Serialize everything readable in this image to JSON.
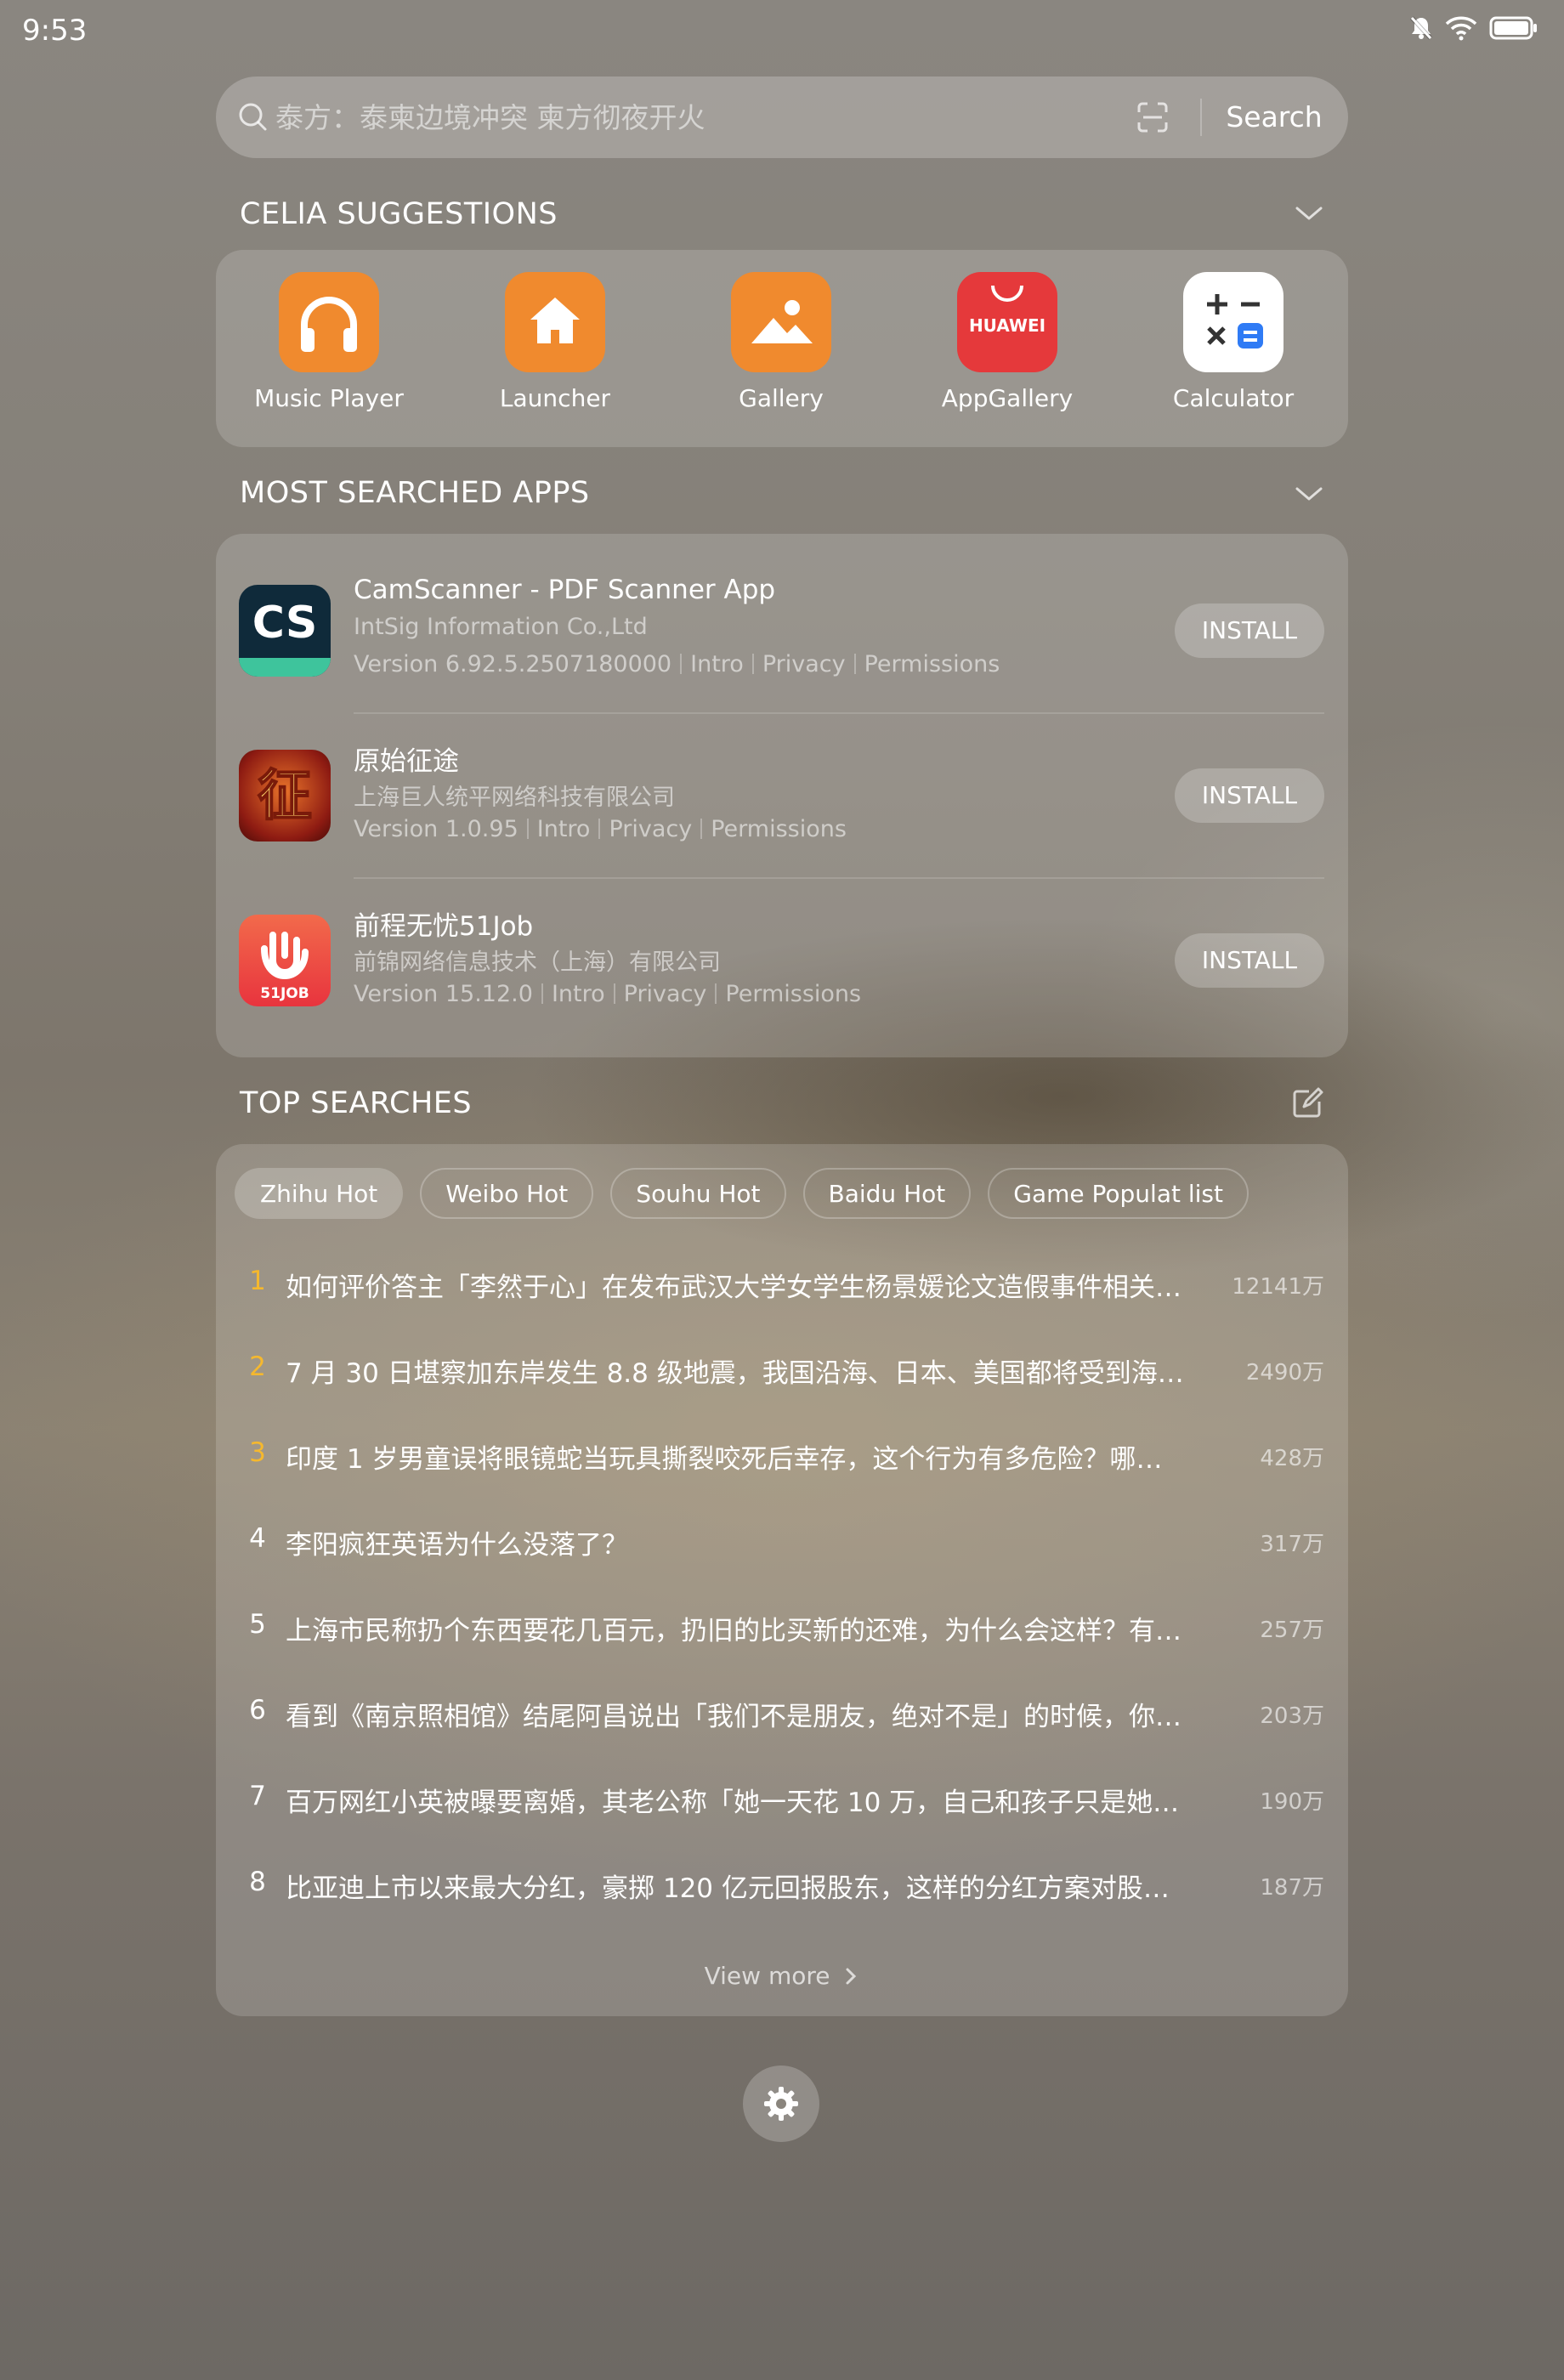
{
  "status_bar": {
    "time": "9:53",
    "icons": [
      "mute-bell-icon",
      "wifi-icon",
      "battery-icon"
    ]
  },
  "search": {
    "placeholder": "泰方：泰柬边境冲突 柬方彻夜开火",
    "button_label": "Search",
    "icons": [
      "search-icon",
      "scan-icon"
    ]
  },
  "celia": {
    "title": "CELIA SUGGESTIONS",
    "items": [
      {
        "label": "Music Player",
        "icon": "headphones-icon",
        "color": "#F08A2E"
      },
      {
        "label": "Launcher",
        "icon": "home-icon",
        "color": "#F08A2E"
      },
      {
        "label": "Gallery",
        "icon": "picture-icon",
        "color": "#F08A2E"
      },
      {
        "label": "AppGallery",
        "icon": "huawei-appgallery-icon",
        "color": "#E5393B",
        "brand": "HUAWEI"
      },
      {
        "label": "Calculator",
        "icon": "calculator-icon",
        "color": "#FFFFFF"
      }
    ]
  },
  "most_searched": {
    "title": "MOST SEARCHED APPS",
    "apps": [
      {
        "name": "CamScanner - PDF Scanner App",
        "developer": "IntSig Information Co.,Ltd",
        "version": "Version 6.92.5.2507180000",
        "intro": "Intro",
        "privacy": "Privacy",
        "permissions": "Permissions",
        "install": "INSTALL",
        "icon_text": "CS"
      },
      {
        "name": "原始征途",
        "developer": "上海巨人统平网络科技有限公司",
        "version": "Version 1.0.95",
        "intro": "Intro",
        "privacy": "Privacy",
        "permissions": "Permissions",
        "install": "INSTALL",
        "icon_text": "征"
      },
      {
        "name": "前程无忧51Job",
        "developer": "前锦网络信息技术（上海）有限公司",
        "version": "Version 15.12.0",
        "intro": "Intro",
        "privacy": "Privacy",
        "permissions": "Permissions",
        "install": "INSTALL",
        "icon_text": "51JOB"
      }
    ]
  },
  "top_searches": {
    "title": "TOP SEARCHES",
    "tabs": [
      "Zhihu Hot",
      "Weibo Hot",
      "Souhu Hot",
      "Baidu Hot",
      "Game Populat list"
    ],
    "active_tab": "Zhihu Hot",
    "rank_highlight_color": "#F5B82E",
    "items": [
      {
        "rank": "1",
        "text": "如何评价答主「李然于心」在发布武汉大学女学生杨景媛论文造假事件相关…",
        "count": "12141万"
      },
      {
        "rank": "2",
        "text": "7 月 30 日堪察加东岸发生 8.8 级地震，我国沿海、日本、美国都将受到海啸…",
        "count": "2490万"
      },
      {
        "rank": "3",
        "text": "印度 1 岁男童误将眼镜蛇当玩具撕裂咬死后幸存，这个行为有多危险？哪些警…",
        "count": "428万"
      },
      {
        "rank": "4",
        "text": "李阳疯狂英语为什么没落了？",
        "count": "317万"
      },
      {
        "rank": "5",
        "text": "上海市民称扔个东西要花几百元，扔旧的比买新的还难，为什么会这样？有哪…",
        "count": "257万"
      },
      {
        "rank": "6",
        "text": "看到《南京照相馆》结尾阿昌说出「我们不是朋友，绝对不是」的时候，你的…",
        "count": "203万"
      },
      {
        "rank": "7",
        "text": "百万网红小英被曝要离婚，其老公称「她一天花 10 万，自己和孩子只是她赚…",
        "count": "190万"
      },
      {
        "rank": "8",
        "text": "比亚迪上市以来最大分红，豪掷 120 亿元回报股东，这样的分红方案对股东和…",
        "count": "187万"
      }
    ],
    "view_more": "View more"
  },
  "footer": {
    "settings_icon": "gear-icon"
  }
}
